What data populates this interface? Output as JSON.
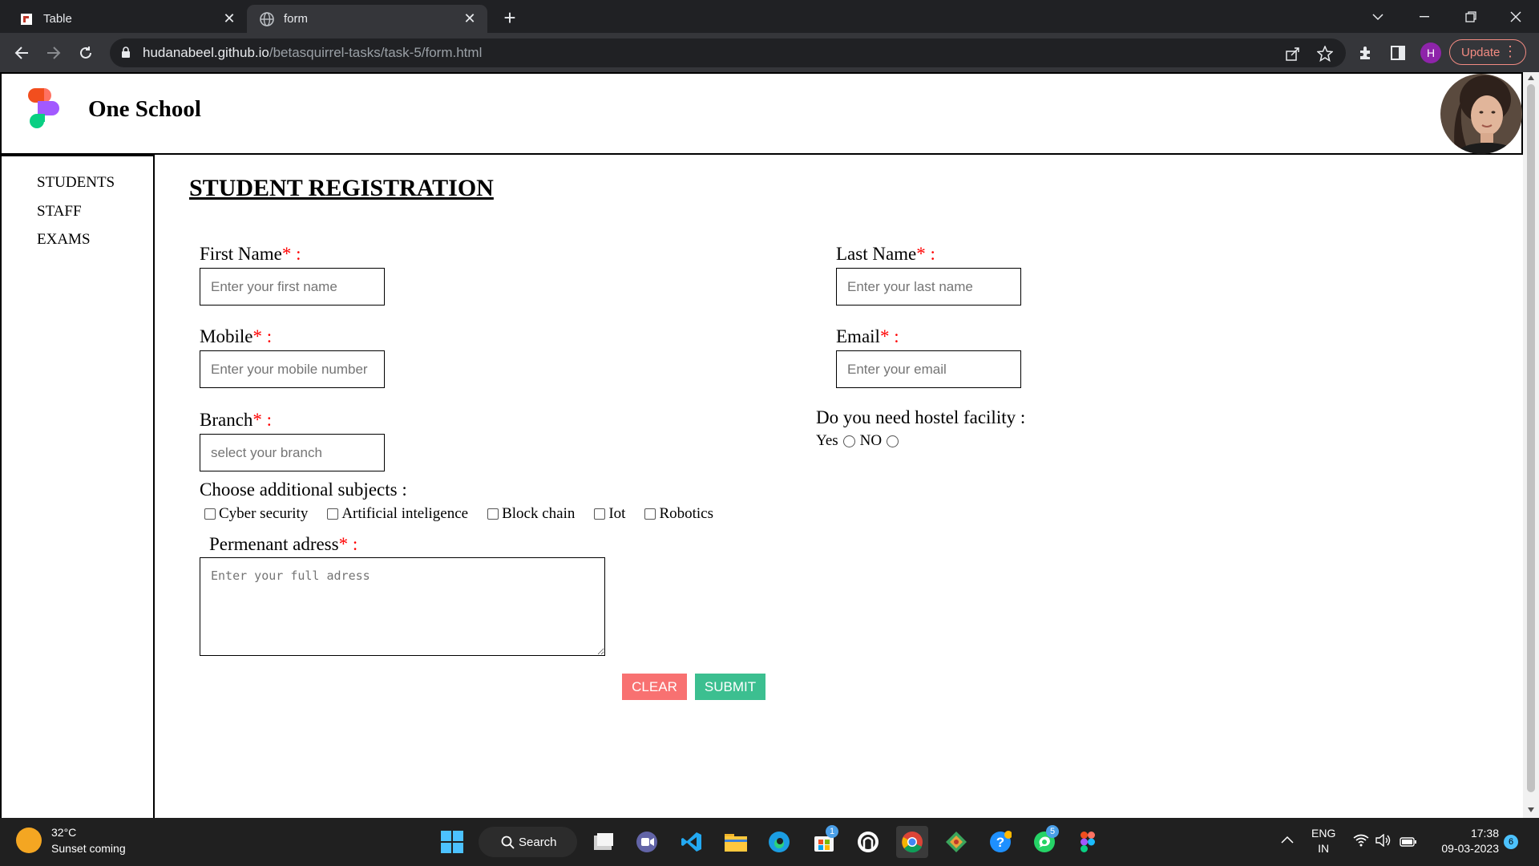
{
  "browser": {
    "tabs": [
      {
        "label": "Table",
        "active": false
      },
      {
        "label": "form",
        "active": true
      }
    ],
    "url_host": "hudanabeel.github.io",
    "url_path": "/betasquirrel-tasks/task-5/form.html",
    "profile_initial": "H",
    "update_label": "Update"
  },
  "site": {
    "title": "One School",
    "nav": [
      "STUDENTS",
      "STAFF",
      "EXAMS"
    ]
  },
  "form": {
    "heading": "STUDENT REGISTRATION",
    "first_name": {
      "label": "First Name",
      "placeholder": "Enter your first name"
    },
    "last_name": {
      "label": "Last Name",
      "placeholder": "Enter your last name"
    },
    "mobile": {
      "label": "Mobile",
      "placeholder": "Enter your mobile number"
    },
    "email": {
      "label": "Email",
      "placeholder": "Enter your email"
    },
    "branch": {
      "label": "Branch",
      "placeholder": "select your branch"
    },
    "required_mark": "*",
    "colon": ":",
    "hostel": {
      "label": "Do you need hostel facility :",
      "yes": "Yes",
      "no": "NO"
    },
    "subjects": {
      "label": "Choose additional subjects :",
      "options": [
        "Cyber security",
        "Artificial inteligence",
        "Block chain",
        "Iot",
        "Robotics"
      ]
    },
    "address": {
      "label": "Permenant adress",
      "placeholder": "Enter your full adress"
    },
    "clear_label": "CLEAR",
    "submit_label": "SUBMIT"
  },
  "taskbar": {
    "weather_temp": "32°C",
    "weather_desc": "Sunset coming",
    "search_label": "Search",
    "lang_top": "ENG",
    "lang_bottom": "IN",
    "time": "17:38",
    "date": "09-03-2023",
    "notification_count": "6",
    "store_badge": "1",
    "whatsapp_badge": "5"
  },
  "colors": {
    "required": "#ff0000",
    "clear_button": "#f87171",
    "submit_button": "#3cbf90",
    "browser_dark": "#202124"
  }
}
